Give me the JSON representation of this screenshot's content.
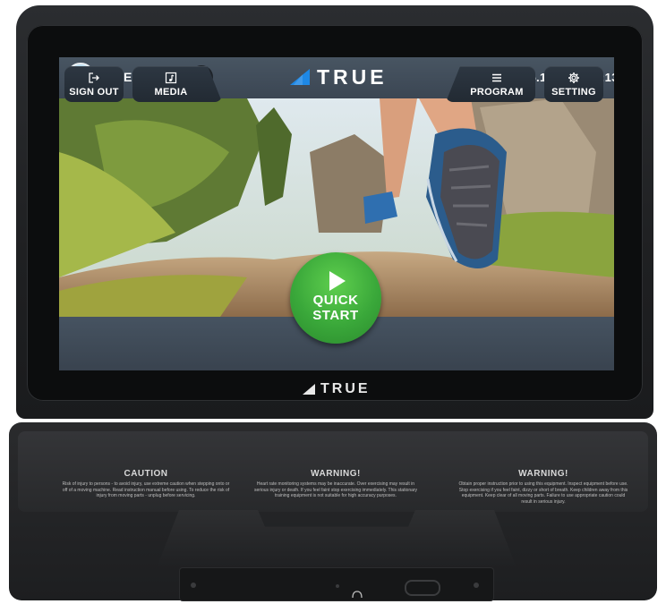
{
  "header": {
    "user_label": "GUEST",
    "brand": "TRUE",
    "datetime": "05.13.2025 15:13"
  },
  "controls": {
    "sign_out_label": "SIGN OUT",
    "media_label": "MEDIA",
    "quick_start_line1": "QUICK",
    "quick_start_line2": "START",
    "program_label": "PROGRAM",
    "setting_label": "SETTING"
  },
  "bezel": {
    "brand": "TRUE"
  },
  "warnings": [
    {
      "title": "CAUTION",
      "body": "Risk of injury to persons - to avoid injury, use extreme caution when stepping onto or off of a moving machine. Read instruction manual before using. To reduce the risk of injury from moving parts - unplug before servicing."
    },
    {
      "title": "WARNING!",
      "body": "Heart rate monitoring systems may be inaccurate. Over exercising may result in serious injury or death. If you feel faint stop exercising immediately. This stationary training equipment is not suitable for high accuracy purposes."
    },
    {
      "title": "WARNING!",
      "body": "Obtain proper instruction prior to using this equipment. Inspect equipment before use. Stop exercising if you feel faint, dizzy or short of breath. Keep children away from this equipment. Keep clear of all moving parts. Failure to use appropriate caution could result in serious injury."
    }
  ],
  "colors": {
    "quick_start_green": "#3aa83a",
    "brand_blue": "#1e88e5",
    "status_bar": "#3f4a57"
  },
  "icons": [
    "avatar",
    "pencil-icon",
    "heart-rate-off-icon",
    "bluetooth-icon",
    "wifi-icon",
    "logout-icon",
    "media-icon",
    "play-icon",
    "list-icon",
    "gear-icon"
  ]
}
